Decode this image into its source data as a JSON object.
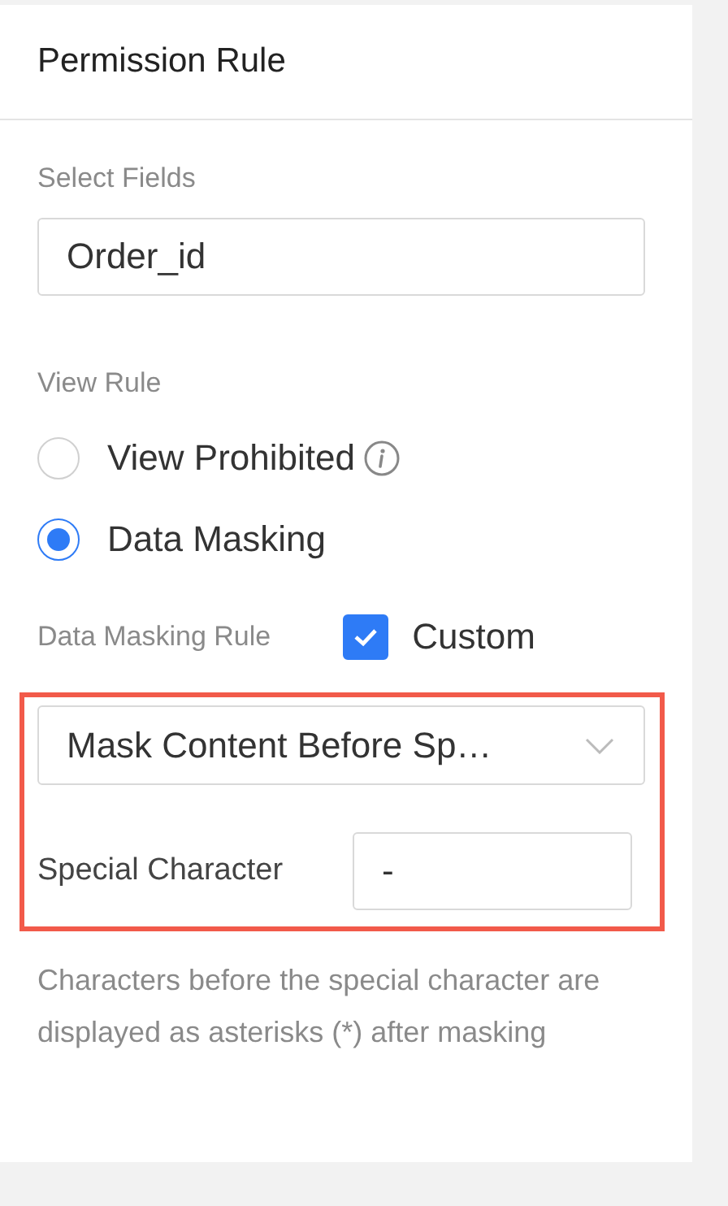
{
  "panel": {
    "title": "Permission Rule"
  },
  "select_fields": {
    "label": "Select Fields",
    "value": "Order_id"
  },
  "view_rule": {
    "label": "View Rule",
    "options": [
      {
        "label": "View Prohibited",
        "selected": false,
        "info": true
      },
      {
        "label": "Data Masking",
        "selected": true,
        "info": false
      }
    ]
  },
  "masking_rule": {
    "label": "Data Masking Rule",
    "custom": {
      "label": "Custom",
      "checked": true
    },
    "method": {
      "value": "Mask Content Before Sp…"
    },
    "special_character": {
      "label": "Special Character",
      "value": "-"
    },
    "help": "Characters before the special character are displayed as asterisks (*) after masking"
  }
}
